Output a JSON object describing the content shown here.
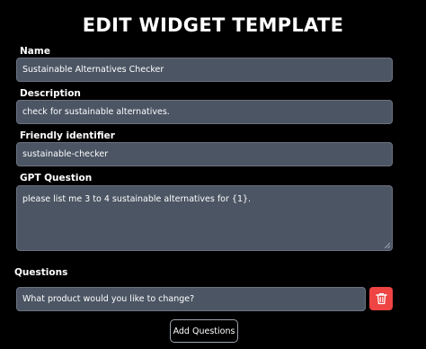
{
  "page": {
    "title": "EDIT WIDGET TEMPLATE"
  },
  "form": {
    "name": {
      "label": "Name",
      "value": "Sustainable Alternatives Checker"
    },
    "description": {
      "label": "Description",
      "value": "check for sustainable alternatives."
    },
    "friendly_identifier": {
      "label": "Friendly identifier",
      "value": "sustainable-checker"
    },
    "gpt_question": {
      "label": "GPT Question",
      "value": "please list me 3 to 4 sustainable alternatives for {1}."
    }
  },
  "questions": {
    "label": "Questions",
    "items": [
      {
        "value": "What product would you like to change?",
        "delete_icon": "trash-icon"
      }
    ],
    "add_button_label": "Add Questions"
  },
  "colors": {
    "background": "#000000",
    "input_background": "#4b5563",
    "delete_button": "#ef4444"
  }
}
